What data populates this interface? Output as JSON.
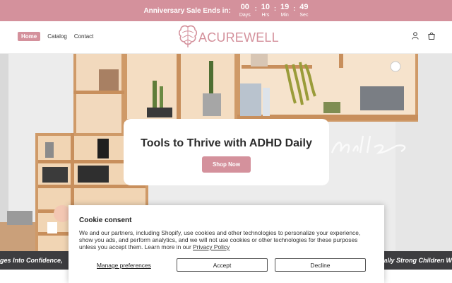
{
  "announcement": {
    "text": "Anniversary Sale Ends in:",
    "countdown": [
      {
        "value": "00",
        "label": "Days"
      },
      {
        "value": "10",
        "label": "Hrs"
      },
      {
        "value": "19",
        "label": "Min"
      },
      {
        "value": "49",
        "label": "Sec"
      }
    ],
    "separator": ":"
  },
  "nav": {
    "items": [
      {
        "label": "Home",
        "active": true
      },
      {
        "label": "Catalog",
        "active": false
      },
      {
        "label": "Contact",
        "active": false
      }
    ]
  },
  "logo": {
    "text": "ACUREWELL",
    "icon": "brain-icon"
  },
  "header_icons": [
    "account-icon",
    "cart-icon"
  ],
  "hero": {
    "title": "Tools to Thrive with ADHD Daily",
    "button": "Shop Now"
  },
  "marquee": {
    "left": "ges Into Confidence,",
    "right": "ally Strong Children W"
  },
  "cookie": {
    "title": "Cookie consent",
    "body": "We and our partners, including Shopify, use cookies and other technologies to personalize your experience, show you ads, and perform analytics, and we will not use cookies or other technologies for these purposes unless you accept them. Learn more in our",
    "link": "Privacy Policy",
    "manage": "Manage preferences",
    "accept": "Accept",
    "decline": "Decline"
  },
  "colors": {
    "brand": "#d4919c",
    "marquee_bg": "#3d3d40"
  }
}
